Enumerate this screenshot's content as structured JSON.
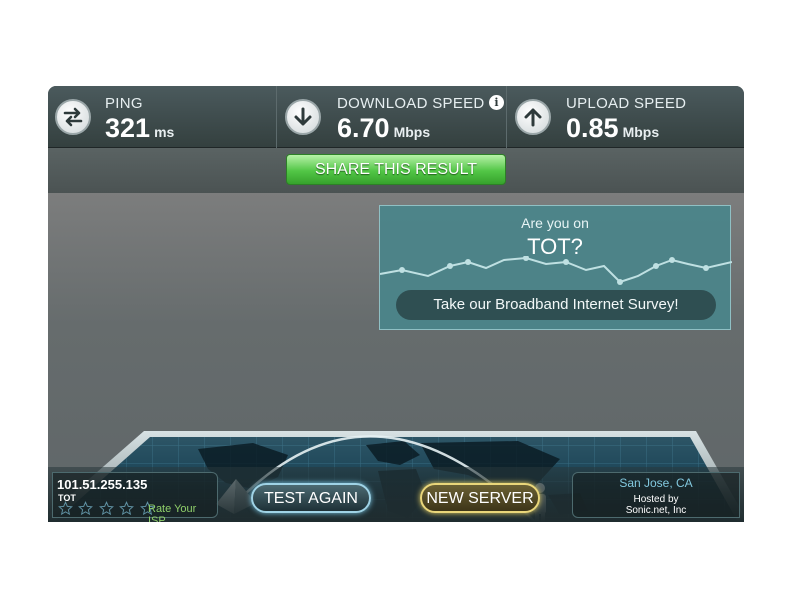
{
  "stats": {
    "ping": {
      "label": "PING",
      "value": "321",
      "unit": "ms",
      "icon": "swap-arrows-icon"
    },
    "download": {
      "label": "DOWNLOAD SPEED",
      "value": "6.70",
      "unit": "Mbps",
      "icon": "arrow-down-icon",
      "info_icon": "i"
    },
    "upload": {
      "label": "UPLOAD SPEED",
      "value": "0.85",
      "unit": "Mbps",
      "icon": "arrow-up-icon"
    }
  },
  "share": {
    "label": "SHARE THIS RESULT"
  },
  "survey": {
    "question": "Are you on",
    "isp": "TOT?",
    "cta": "Take our Broadband Internet Survey!"
  },
  "isp": {
    "ip": "101.51.255.135",
    "name": "TOT",
    "rating_stars": 0,
    "rate_label": "Rate Your ISP"
  },
  "buttons": {
    "test_again": "TEST AGAIN",
    "new_server": "NEW SERVER"
  },
  "server": {
    "city": "San Jose, CA",
    "hosted_label": "Hosted by",
    "host": "Sonic.net, Inc"
  },
  "colors": {
    "accent_green": "#52c646",
    "accent_blue": "#79c6e3",
    "accent_gold": "#e4cf64",
    "survey_teal": "#4a848a"
  }
}
